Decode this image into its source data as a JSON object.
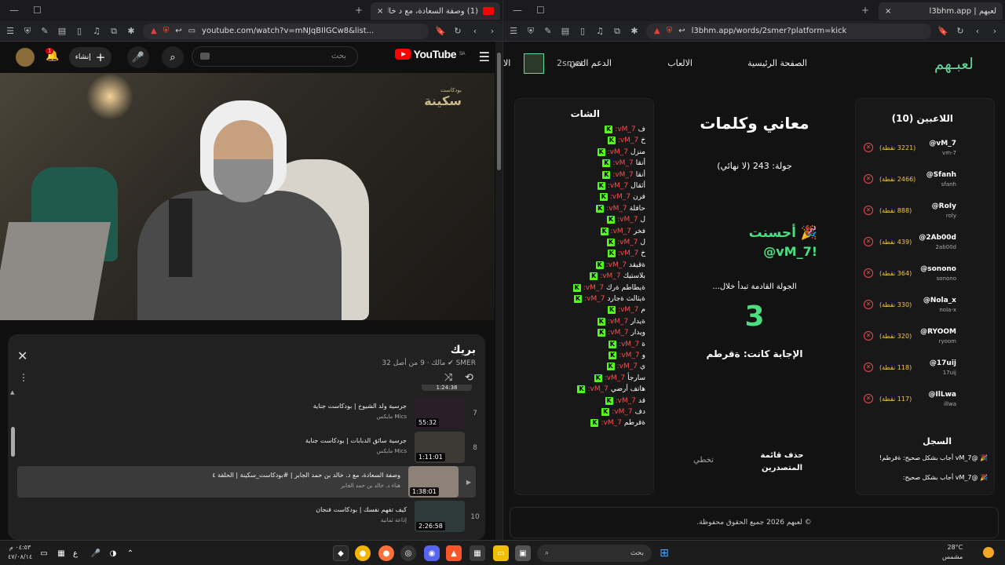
{
  "left_window": {
    "tab_title": "(1) وصفة السعادة، مع د خالد بن",
    "new_tab": "+",
    "url": "youtube.com/watch?v=mNJqBIlGCw8&list...",
    "youtube": {
      "logo": "YouTube",
      "region": "SA",
      "search_placeholder": "بحث",
      "create_label": "إنشاء",
      "notif_count": "1",
      "video_watermark_small": "بودكاست",
      "video_watermark": "سكينة",
      "playlist": {
        "title": "بريك",
        "subtitle": "SMER ✔ مالك · 9 من أصل 32",
        "items": [
          {
            "num": "7",
            "title": "جرسية ولد الشيوخ | بودكاست جناية",
            "channel": "Mics مايكس",
            "duration": "55:32"
          },
          {
            "num": "8",
            "title": "جرسية سائق الدبابات | بودكاست جناية",
            "channel": "Mics مايكس",
            "duration": "1:11:01"
          },
          {
            "num": "",
            "title": "وصفة السعادة، مع د. خالد بن حمد الجابر | #بودكاست_سكينة | الحلقة ٤",
            "channel": "هناء د. خالد بن حمد الجابر",
            "duration": "1:38:01"
          },
          {
            "num": "10",
            "title": "كيف تفهم نفسك | بودكاست فنجان",
            "channel": "إذاعة ثمانية",
            "duration": "2:26:58"
          }
        ],
        "top_partial_duration": "1:24:38"
      }
    }
  },
  "right_window": {
    "tab_title": "l3bhm.app | لعبهم",
    "url": "l3bhm.app/words/2smer?platform=kick",
    "site": {
      "logo": "لعبـهم",
      "nav": {
        "home": "الصفحة الرئيسية",
        "games": "الالعاب",
        "support": "الدعم الفني",
        "user": "2smer",
        "partial": "الا"
      },
      "players_title": "اللاعبين (10)",
      "players": [
        {
          "name": "@vM_7",
          "user": "vm-7",
          "points": "(3221 نقطة)"
        },
        {
          "name": "@Sfanh",
          "user": "sfanh",
          "points": "(2466 نقطة)"
        },
        {
          "name": "@RoIy",
          "user": "roly",
          "points": "(888 نقطة)"
        },
        {
          "name": "@2Ab00d",
          "user": "2ab00d",
          "points": "(439 نقطة)"
        },
        {
          "name": "@sonono",
          "user": "sonono",
          "points": "(364 نقطة)"
        },
        {
          "name": "@Nola_x",
          "user": "nola-x",
          "points": "(330 نقطة)"
        },
        {
          "name": "@RYOOM",
          "user": "ryoom",
          "points": "(320 نقطة)"
        },
        {
          "name": "@17uij",
          "user": "17uij",
          "points": "(118 نقطة)"
        },
        {
          "name": "@IlLwa",
          "user": "illwa",
          "points": "(117 نقطة)"
        }
      ],
      "log_title": "السجل",
      "log_entries": [
        "🎉 @vM_7 أجاب بشكل صحيح: ةقرطم!",
        "🎉 @vM_7 أجاب بشكل صحيح:"
      ],
      "game_title": "معاني وكلمات",
      "round": "جولة: 243 (لا نهائي)",
      "congrats_line1": "🎉 أحسنت",
      "congrats_line2": "@vM_7!",
      "next_round": "الجولة القادمة تبدأ خلال...",
      "countdown": "3",
      "answer": "الإجابة كانت: ةقرطم",
      "delete_leaderboard_1": "حذف قائمة",
      "delete_leaderboard_2": "المتصدرين",
      "skip": "تخطي",
      "chat_title": "الشات",
      "chat_user": "vM_7:",
      "chat_messages": [
        "ف",
        "خ",
        "منزل",
        "أنقا",
        "أنقا",
        "أثقال",
        "فرن",
        "حافلة",
        "ل",
        "فخر",
        "ل",
        "خ",
        "ةقيقد",
        "بلاستيك",
        "ةيطاطم ةرك",
        "ةيثالث ةجارد",
        "م",
        "ةيدار",
        "ويدار",
        "ة",
        "و",
        "ي",
        "سارجأ",
        "هاتف أرضي",
        "قد",
        "دف",
        "ةقرطم"
      ],
      "footer": "© لعبهم 2026 جميع الحقوق محفوظة."
    }
  },
  "taskbar": {
    "search": "بحث",
    "weather_temp": "28°C",
    "weather_desc": "مشمس",
    "time": "٠٤:٥٣ م",
    "date": "٤٧/٠٨/١٤",
    "lang": "ع"
  },
  "colors": {
    "kick_green": "#53fc18",
    "accent_green": "#5fd79a",
    "points_gold": "#f5c64b",
    "youtube_red": "#ff0000"
  }
}
